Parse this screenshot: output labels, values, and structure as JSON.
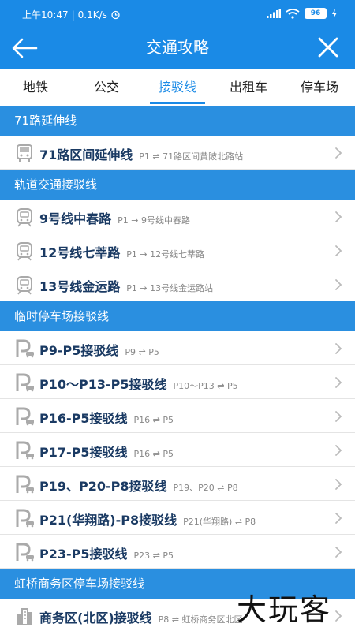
{
  "status": {
    "time": "上午10:47",
    "speed": "0.1K/s",
    "battery": "96"
  },
  "title": "交通攻略",
  "tabs": [
    "地铁",
    "公交",
    "接驳线",
    "出租车",
    "停车场"
  ],
  "sections": [
    {
      "header": "71路延伸线",
      "rows": [
        {
          "icon": "bus-icon",
          "name": "71路区间延伸线",
          "route": "P1 ⇌ 71路区间黄陂北路站"
        }
      ]
    },
    {
      "header": "轨道交通接驳线",
      "rows": [
        {
          "icon": "metro-icon",
          "name": "9号线中春路",
          "route": "P1 → 9号线中春路"
        },
        {
          "icon": "metro-icon",
          "name": "12号线七莘路",
          "route": "P1 → 12号线七莘路"
        },
        {
          "icon": "metro-icon",
          "name": "13号线金运路",
          "route": "P1 → 13号线金运路站"
        }
      ]
    },
    {
      "header": "临时停车场接驳线",
      "rows": [
        {
          "icon": "parking-icon",
          "name": "P9-P5接驳线",
          "route": "P9 ⇌ P5"
        },
        {
          "icon": "parking-icon",
          "name": "P10〜P13-P5接驳线",
          "route": "P10〜P13 ⇌ P5"
        },
        {
          "icon": "parking-icon",
          "name": "P16-P5接驳线",
          "route": "P16 ⇌ P5"
        },
        {
          "icon": "parking-icon",
          "name": "P17-P5接驳线",
          "route": "P16 ⇌ P5"
        },
        {
          "icon": "parking-icon",
          "name": "P19、P20-P8接驳线",
          "route": "P19、P20 ⇌ P8"
        },
        {
          "icon": "parking-icon",
          "name": "P21(华翔路)-P8接驳线",
          "route": "P21(华翔路) ⇌ P8"
        },
        {
          "icon": "parking-icon",
          "name": "P23-P5接驳线",
          "route": "P23 ⇌ P5"
        }
      ]
    },
    {
      "header": "虹桥商务区停车场接驳线",
      "rows": [
        {
          "icon": "building-icon",
          "name": "商务区(北区)接驳线",
          "route": "P8 ⇌ 虹桥商务区北区"
        }
      ]
    }
  ],
  "watermark": "大玩客",
  "colors": {
    "accent": "#1a8ae6",
    "section": "#2a8fe0",
    "rowText": "#1a3a63"
  }
}
